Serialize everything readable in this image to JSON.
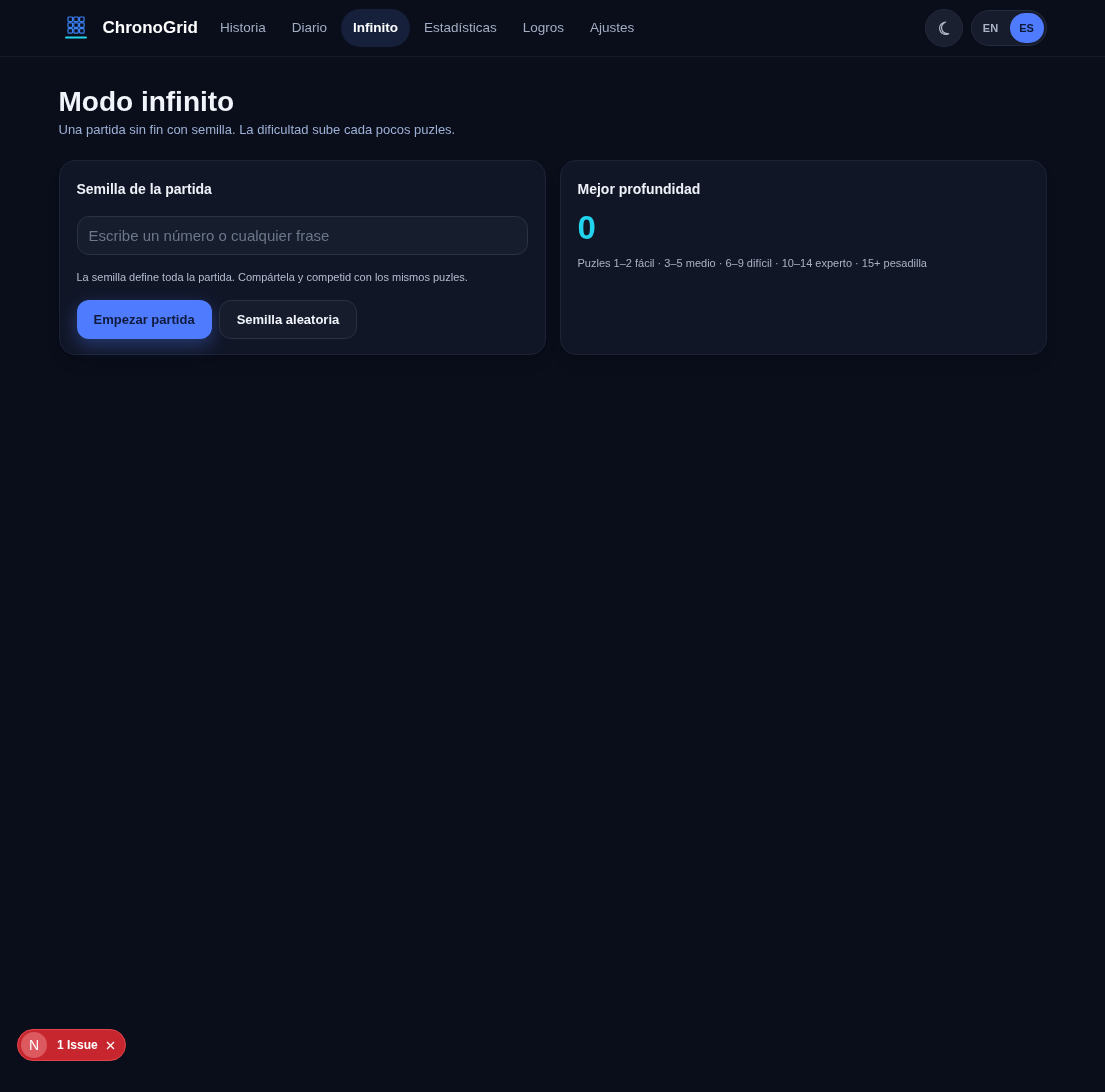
{
  "brand": {
    "name": "ChronoGrid"
  },
  "nav": [
    {
      "label": "Historia",
      "selected": false
    },
    {
      "label": "Diario",
      "selected": false
    },
    {
      "label": "Infinito",
      "selected": true
    },
    {
      "label": "Estadísticas",
      "selected": false
    },
    {
      "label": "Logros",
      "selected": false
    },
    {
      "label": "Ajustes",
      "selected": false
    }
  ],
  "language": [
    {
      "label": "EN",
      "selected": false
    },
    {
      "label": "ES",
      "selected": true
    }
  ],
  "page": {
    "title": "Modo infinito",
    "subtitle": "Una partida sin fin con semilla. La dificultad sube cada pocos puzles."
  },
  "seed_card": {
    "title": "Semilla de la partida",
    "placeholder": "Escribe un número o cualquier frase",
    "help": "La semilla define toda la partida. Compártela y competid con los mismos puzles.",
    "buttons": [
      {
        "label": "Empezar partida",
        "kind": "primary"
      },
      {
        "label": "Semilla aleatoria",
        "kind": "secondary"
      }
    ]
  },
  "depth_card": {
    "title": "Mejor profundidad",
    "value": "0",
    "legend": "Puzles 1–2 fácil · 3–5 medio · 6–9 difícil · 10–14 experto · 15+ pesadilla"
  },
  "issue_badge": {
    "mark": "N",
    "label": "1 Issue"
  }
}
